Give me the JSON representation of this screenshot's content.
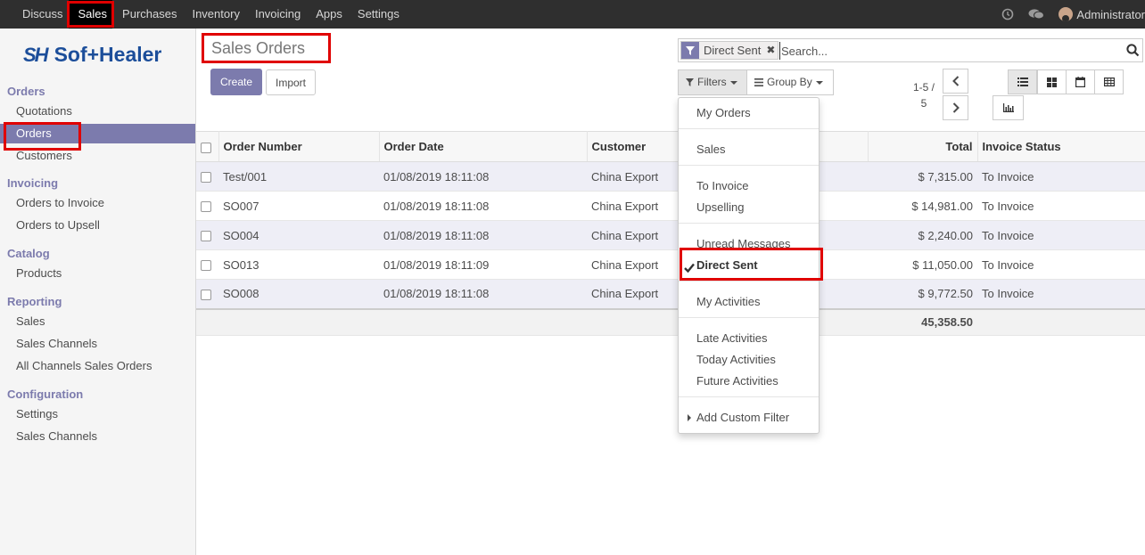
{
  "topbar": {
    "menu": [
      "Discuss",
      "Sales",
      "Purchases",
      "Inventory",
      "Invoicing",
      "Apps",
      "Settings"
    ],
    "active_menu": "Sales",
    "user": "Administrator"
  },
  "sidebar": {
    "logo_text": "Sof+Healer",
    "logo_mark": "SH",
    "sections": [
      {
        "title": "Orders",
        "items": [
          "Quotations",
          "Orders",
          "Customers"
        ]
      },
      {
        "title": "Invoicing",
        "items": [
          "Orders to Invoice",
          "Orders to Upsell"
        ]
      },
      {
        "title": "Catalog",
        "items": [
          "Products"
        ]
      },
      {
        "title": "Reporting",
        "items": [
          "Sales",
          "Sales Channels",
          "All Channels Sales Orders"
        ]
      },
      {
        "title": "Configuration",
        "items": [
          "Settings",
          "Sales Channels"
        ]
      }
    ],
    "active_item": "Orders"
  },
  "page": {
    "title": "Sales Orders",
    "create_label": "Create",
    "import_label": "Import"
  },
  "search": {
    "facet_label": "Direct Sent",
    "placeholder": "Search..."
  },
  "filters": {
    "filters_label": "Filters",
    "groupby_label": "Group By",
    "menu": [
      [
        "My Orders"
      ],
      [
        "Sales"
      ],
      [
        "To Invoice",
        "Upselling"
      ],
      [
        "Unread Messages",
        "Direct Sent"
      ],
      [
        "My Activities"
      ],
      [
        "Late Activities",
        "Today Activities",
        "Future Activities"
      ]
    ],
    "selected": "Direct Sent",
    "custom_filter_label": "Add Custom Filter"
  },
  "pager": {
    "line1": "1-5 /",
    "line2": "5"
  },
  "table": {
    "columns": [
      "Order Number",
      "Order Date",
      "Customer",
      "Total",
      "Invoice Status"
    ],
    "rows": [
      {
        "number": "Test/001",
        "date": "01/08/2019 18:11:08",
        "customer": "China Export",
        "total": "$ 7,315.00",
        "status": "To Invoice"
      },
      {
        "number": "SO007",
        "date": "01/08/2019 18:11:08",
        "customer": "China Export",
        "total": "$ 14,981.00",
        "status": "To Invoice"
      },
      {
        "number": "SO004",
        "date": "01/08/2019 18:11:08",
        "customer": "China Export",
        "total": "$ 2,240.00",
        "status": "To Invoice"
      },
      {
        "number": "SO013",
        "date": "01/08/2019 18:11:09",
        "customer": "China Export",
        "total": "$ 11,050.00",
        "status": "To Invoice"
      },
      {
        "number": "SO008",
        "date": "01/08/2019 18:11:08",
        "customer": "China Export",
        "total": "$ 9,772.50",
        "status": "To Invoice"
      }
    ],
    "footer_total": "45,358.50"
  },
  "colors": {
    "accent": "#7c7bad",
    "highlight": "#e00000",
    "navbar": "#2f2f2f"
  },
  "icons": {
    "clock": "clock-icon",
    "chat": "chat-icon",
    "filter": "filter-icon",
    "search": "search-icon",
    "list": "list-view-icon",
    "kanban": "kanban-view-icon",
    "calendar": "calendar-view-icon",
    "pivot": "pivot-view-icon",
    "graph": "graph-view-icon"
  }
}
